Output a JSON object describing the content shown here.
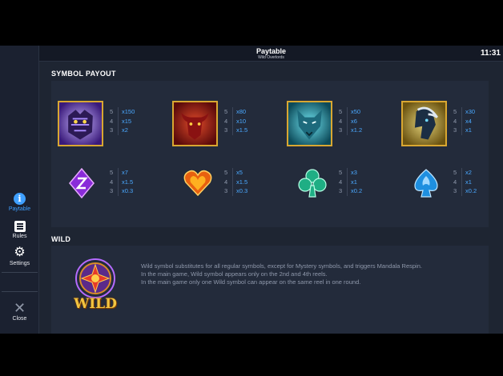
{
  "header": {
    "title": "Paytable",
    "subtitle": "Wild Overlords",
    "time": "11:31"
  },
  "nav": {
    "paytable": "Paytable",
    "rules": "Rules",
    "settings": "Settings",
    "close": "Close"
  },
  "sections": {
    "symbol_payout": "SYMBOL PAYOUT",
    "wild": "WILD"
  },
  "symbols": [
    {
      "name": "tiger",
      "pays": [
        {
          "k": "5",
          "v": "x150"
        },
        {
          "k": "4",
          "v": "x15"
        },
        {
          "k": "3",
          "v": "x2"
        }
      ]
    },
    {
      "name": "bull",
      "pays": [
        {
          "k": "5",
          "v": "x80"
        },
        {
          "k": "4",
          "v": "x10"
        },
        {
          "k": "3",
          "v": "x1.5"
        }
      ]
    },
    {
      "name": "wolf",
      "pays": [
        {
          "k": "5",
          "v": "x50"
        },
        {
          "k": "4",
          "v": "x6"
        },
        {
          "k": "3",
          "v": "x1.2"
        }
      ]
    },
    {
      "name": "horse",
      "pays": [
        {
          "k": "5",
          "v": "x30"
        },
        {
          "k": "4",
          "v": "x4"
        },
        {
          "k": "3",
          "v": "x1"
        }
      ]
    },
    {
      "name": "diamond",
      "pays": [
        {
          "k": "5",
          "v": "x7"
        },
        {
          "k": "4",
          "v": "x1.5"
        },
        {
          "k": "3",
          "v": "x0.3"
        }
      ]
    },
    {
      "name": "heart",
      "pays": [
        {
          "k": "5",
          "v": "x5"
        },
        {
          "k": "4",
          "v": "x1.5"
        },
        {
          "k": "3",
          "v": "x0.3"
        }
      ]
    },
    {
      "name": "club",
      "pays": [
        {
          "k": "5",
          "v": "x3"
        },
        {
          "k": "4",
          "v": "x1"
        },
        {
          "k": "3",
          "v": "x0.2"
        }
      ]
    },
    {
      "name": "spade",
      "pays": [
        {
          "k": "5",
          "v": "x2"
        },
        {
          "k": "4",
          "v": "x1"
        },
        {
          "k": "3",
          "v": "x0.2"
        }
      ]
    }
  ],
  "wild": {
    "logo_text": "WILD",
    "lines": [
      "Wild symbol substitutes for all regular symbols, except for Mystery symbols, and triggers Mandala Respin.",
      "In the main game, Wild symbol appears only on the 2nd and 4th reels.",
      "In the main game only one Wild symbol can appear on the same reel in one round."
    ]
  },
  "colors": {
    "accent": "#3fa0ff",
    "payout_value": "#4aa8ff",
    "frame_gold": "#d9a731"
  }
}
